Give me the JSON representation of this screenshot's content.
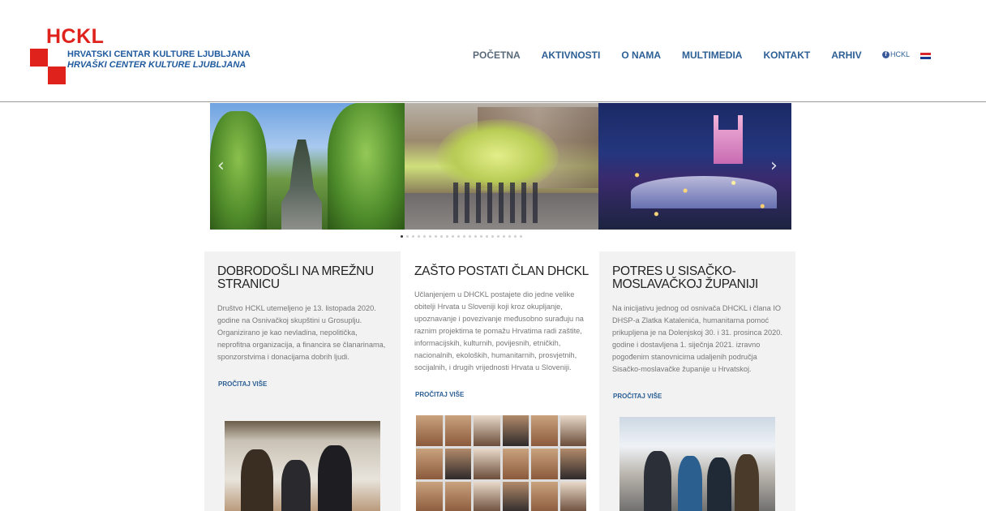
{
  "brand": {
    "name": "HCKL",
    "line1": "HRVATSKI CENTAR KULTURE LJUBLJANA",
    "line2": "HRVAŠKI CENTER KULTURE LJUBLJANA",
    "red": "#e0221d",
    "blue": "#1f5a9e"
  },
  "nav": {
    "items": [
      "POČETNA",
      "AKTIVNOSTI",
      "O NAMA",
      "MULTIMEDIA",
      "KONTAKT",
      "ARHIV"
    ]
  },
  "social": {
    "icon": "facebook-icon",
    "label": "HCKL",
    "flag": "croatia-flag-icon"
  },
  "slider": {
    "prev_icon": "chevron-left-icon",
    "next_icon": "chevron-right-icon",
    "dot_count": 22,
    "active_dot": 0
  },
  "cards": [
    {
      "title": "DOBRODOŠLI NA MREŽNU STRANICU",
      "body": "Društvo HCKL utemeljeno je 13. listopada 2020. godine na Osnivačkoj skupštini u Grosuplju. Organizirano je kao nevladina, nepolitička, neprofitna organizacija, a financira se članarinama, sponzorstvima i donacijama dobrih ljudi.",
      "more": "PROČITAJ VIŠE"
    },
    {
      "title": "ZAŠTO POSTATI ČLAN DHCKL",
      "body": "Učlanjenjem u DHCKL postajete dio jedne velike obitelji Hrvata u Sloveniji koji kroz okupljanje, upoznavanje i povezivanje međusobno surađuju na raznim projektima te pomažu Hrvatima radi zaštite, informacijskih, kulturnih, povijesnih, etničkih, nacionalnih, ekoloških, humanitarnih, prosvjetnih, socijalnih, i drugih vrijednosti Hrvata u Sloveniji.",
      "more": "PROČITAJ VIŠE"
    },
    {
      "title": "POTRES U SISAČKO-MOSLAVAČKOJ ŽUPANIJI",
      "body": "Na inicijativu jednog od osnivača DHCKL i člana IO DHSP-a Zlatka Katalenića, humanitarna pomoć prikupljena je na Dolenjskoj 30. i 31. prosinca 2020. godine i dostavljena 1. siječnja 2021. izravno pogođenim stanovnicima udaljenih područja Sisačko-moslavačke županije u Hrvatskoj.",
      "more": "PROČITAJ VIŠE"
    }
  ]
}
